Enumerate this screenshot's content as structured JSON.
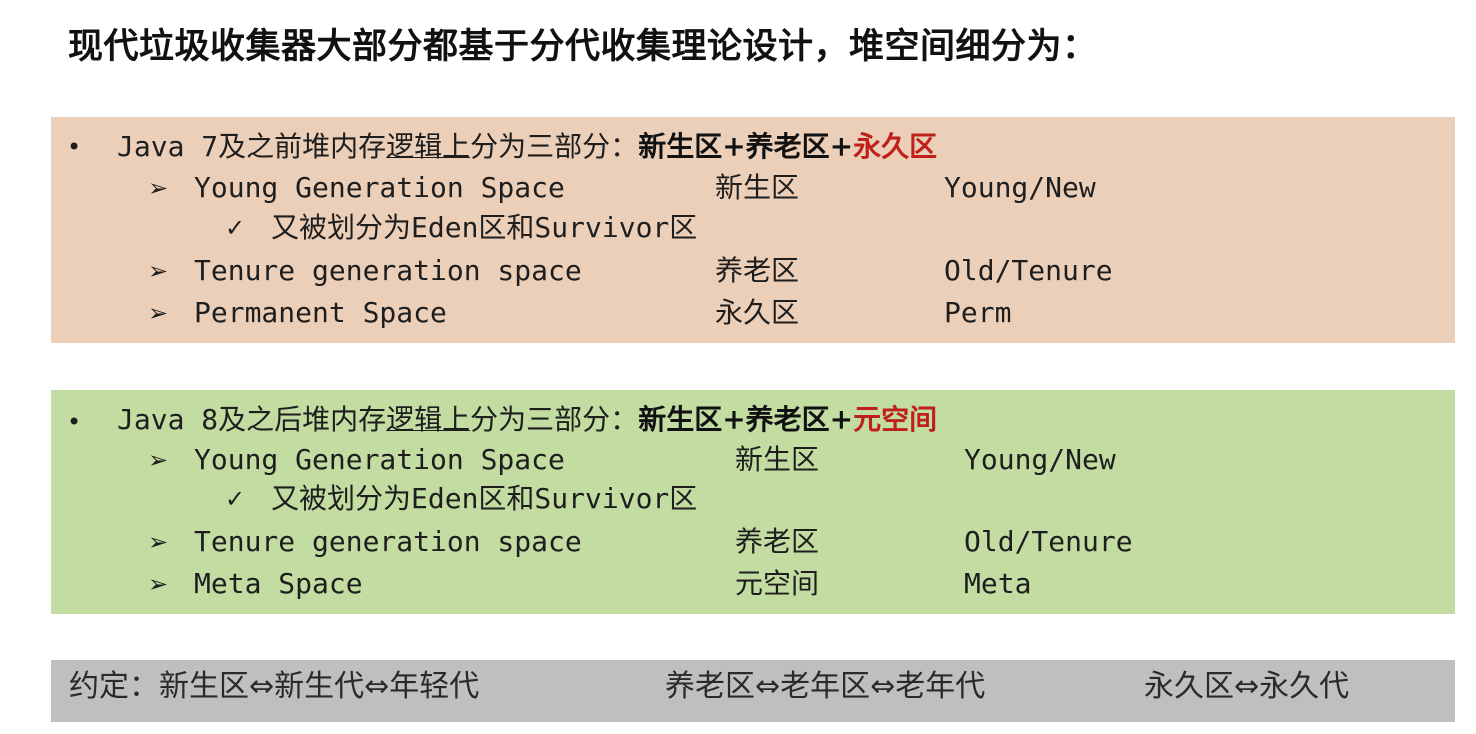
{
  "title": "现代垃圾收集器大部分都基于分代收集理论设计，堆空间细分为：",
  "java7": {
    "bullet": "•",
    "head_prefix": "Java 7及之前堆内存",
    "head_underline": "逻辑上",
    "head_middle": "分为三部分：",
    "head_bold": "新生区+养老区+",
    "head_red": "永久区",
    "rows": [
      {
        "marker": "➢",
        "name": "Young Generation Space",
        "cn": "新生区",
        "alias": "Young/New"
      },
      {
        "marker": "✓",
        "text": "又被划分为Eden区和Survivor区"
      },
      {
        "marker": "➢",
        "name": "Tenure generation space",
        "cn": "养老区",
        "alias": "Old/Tenure"
      },
      {
        "marker": "➢",
        "name": "Permanent Space",
        "cn": "永久区",
        "alias": "Perm"
      }
    ]
  },
  "java8": {
    "bullet": "•",
    "head_prefix": "Java 8及之后堆内存",
    "head_underline": "逻辑上",
    "head_middle": "分为三部分：",
    "head_bold": "新生区+养老区+",
    "head_red": "元空间",
    "rows": [
      {
        "marker": "➢",
        "name": "Young Generation Space",
        "cn": "新生区",
        "alias": "Young/New"
      },
      {
        "marker": "✓",
        "text": "又被划分为Eden区和Survivor区"
      },
      {
        "marker": "➢",
        "name": "Tenure generation space",
        "cn": "养老区",
        "alias": "Old/Tenure"
      },
      {
        "marker": "➢",
        "name": "Meta Space",
        "cn": "元空间",
        "alias": "Meta"
      }
    ]
  },
  "footer": {
    "part1": "约定：新生区⇔新生代⇔年轻代",
    "part2": "养老区⇔老年区⇔老年代",
    "part3": "永久区⇔永久代"
  },
  "colors": {
    "java7_bg": "#eccfb9",
    "java8_bg": "#c2dca2",
    "footer_bg": "#bfbfbf",
    "accent_red": "#c0201c"
  }
}
